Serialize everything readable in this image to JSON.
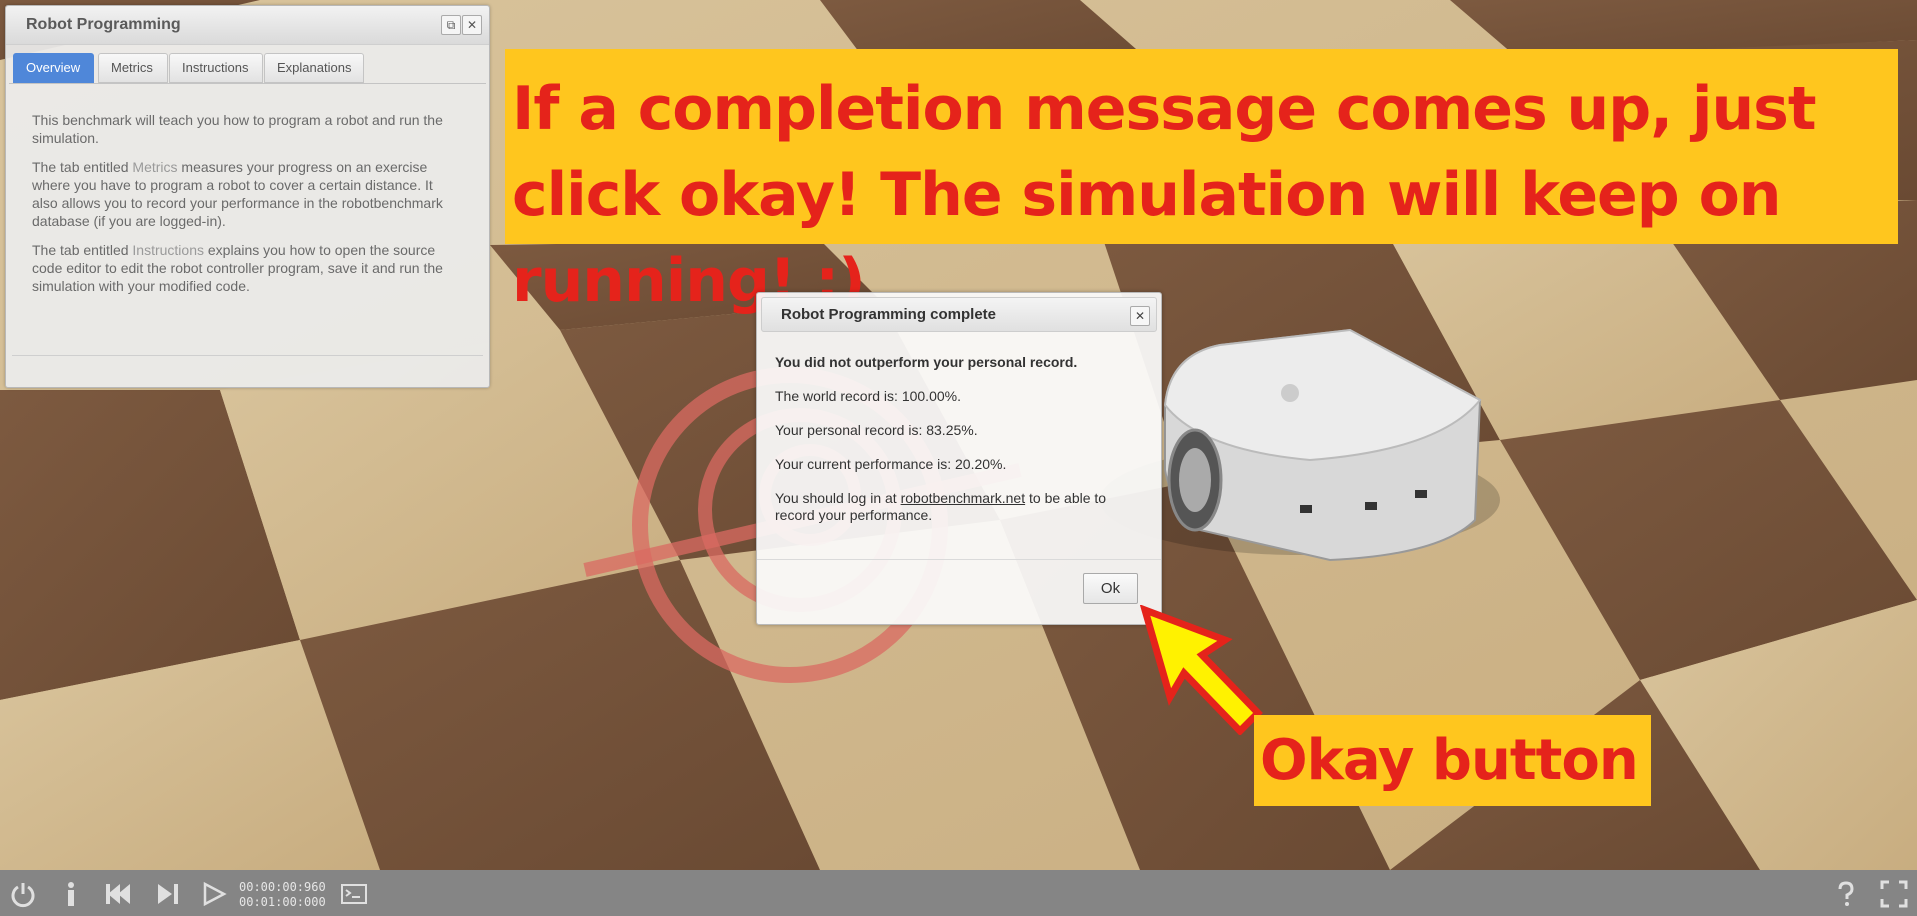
{
  "panel": {
    "title": "Robot Programming",
    "tabs": [
      {
        "label": "Overview",
        "active": true
      },
      {
        "label": "Metrics",
        "active": false
      },
      {
        "label": "Instructions",
        "active": false
      },
      {
        "label": "Explanations",
        "active": false
      }
    ],
    "paragraph1": "This benchmark will teach you how to program a robot and run the simulation.",
    "paragraph2_pre": "The tab entitled ",
    "paragraph2_hl": "Metrics",
    "paragraph2_post": " measures your progress on an exercise where you have to program a robot to cover a certain distance. It also allows you to record your performance in the robotbenchmark database (if you are logged-in).",
    "paragraph3_pre": "The tab entitled ",
    "paragraph3_hl": "Instructions",
    "paragraph3_post": " explains you how to open the source code editor to edit the robot controller program, save it and run the simulation with your modified code."
  },
  "banner": {
    "text": "If a completion message comes up, just click okay! The simulation will keep on running! :)"
  },
  "annotation": {
    "okay_label": "Okay button"
  },
  "dialog": {
    "title": "Robot Programming complete",
    "headline": "You did not outperform your personal record.",
    "world_record": "The world record is: 100.00%.",
    "personal_record": "Your personal record is: 83.25%.",
    "current_performance": "Your current performance is: 20.20%.",
    "login_pre": "You should log in at ",
    "login_link": "robotbenchmark.net",
    "login_post": " to be able to record your performance.",
    "ok_label": "Ok"
  },
  "toolbar": {
    "time_current": "00:00:00:960",
    "time_total": "00:01:00:000"
  },
  "colors": {
    "banner_bg": "#ffc61e",
    "banner_text": "#e5231b",
    "active_tab": "#4f87d9",
    "toolbar_bg": "#858585"
  }
}
